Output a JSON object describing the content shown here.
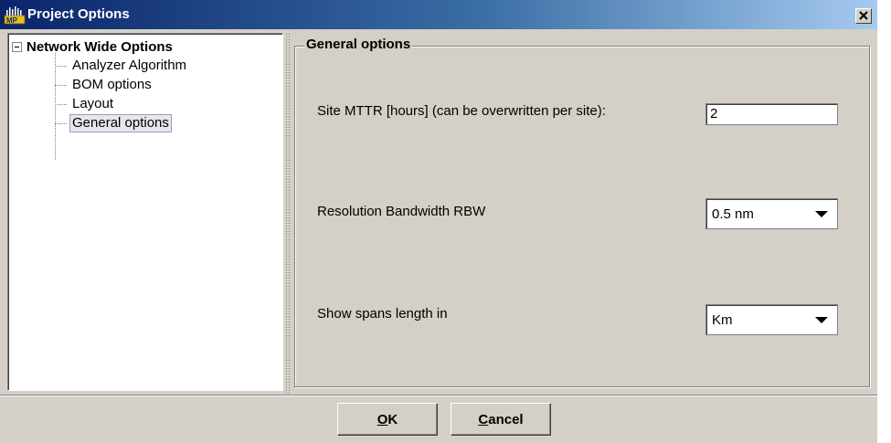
{
  "window": {
    "title": "Project Options",
    "app_icon": "mp-app-icon",
    "close_glyph": "✕"
  },
  "tree": {
    "root_label": "Network Wide Options",
    "items": [
      {
        "label": "Analyzer Algorithm",
        "selected": false
      },
      {
        "label": "BOM options",
        "selected": false
      },
      {
        "label": "Layout",
        "selected": false
      },
      {
        "label": "General options",
        "selected": true
      }
    ]
  },
  "panel": {
    "group_title": "General options",
    "mttr": {
      "label": "Site MTTR [hours] (can be overwritten per site):",
      "value": "2"
    },
    "rbw": {
      "label": "Resolution Bandwidth RBW",
      "selected": "0.5 nm"
    },
    "spans": {
      "label": "Show spans length in",
      "selected": "Km"
    }
  },
  "buttons": {
    "ok": {
      "mnemonic": "O",
      "rest": "K"
    },
    "cancel": {
      "mnemonic": "C",
      "rest": "ancel"
    }
  },
  "colors": {
    "titlebar_start": "#0a246a",
    "titlebar_end": "#a6caf0",
    "dialog_bg": "#d4d0c8"
  }
}
